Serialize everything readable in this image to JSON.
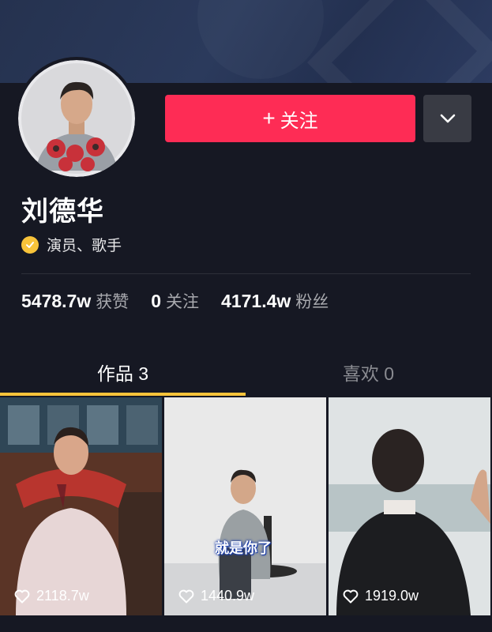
{
  "profile": {
    "name": "刘德华",
    "verified_label": "演员、歌手",
    "follow_label": "关注",
    "follow_plus": "+"
  },
  "stats": [
    {
      "value": "5478.7w",
      "label": "获赞"
    },
    {
      "value": "0",
      "label": "关注"
    },
    {
      "value": "4171.4w",
      "label": "粉丝"
    }
  ],
  "tabs": [
    {
      "label": "作品 3",
      "active": true
    },
    {
      "label": "喜欢 0",
      "active": false
    }
  ],
  "videos": [
    {
      "likes": "2118.7w"
    },
    {
      "likes": "1440.9w",
      "caption": "就是你了"
    },
    {
      "likes": "1919.0w"
    }
  ],
  "colors": {
    "accent": "#fe2c55",
    "background": "#161823",
    "verified": "#f8c33a",
    "tab_indicator": "#f8c33a"
  }
}
